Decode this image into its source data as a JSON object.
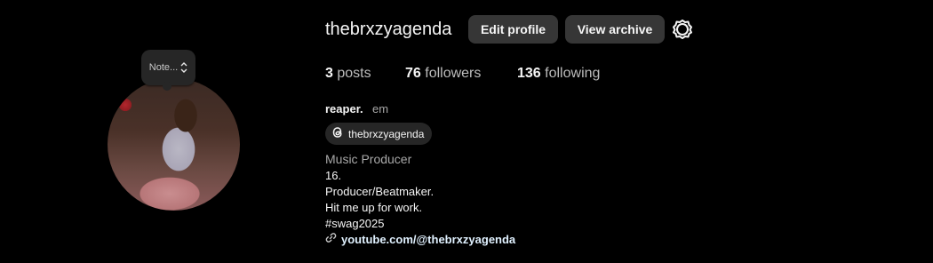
{
  "profile": {
    "username": "thebrxzyagenda",
    "note_placeholder": "Note...",
    "name": "reaper.",
    "pronouns": "em",
    "threads_handle": "thebrxzyagenda",
    "category": "Music Producer",
    "bio_lines": [
      "16.",
      "Producer/Beatmaker.",
      "Hit me up for work.",
      "#swag2025"
    ],
    "link": "youtube.com/@thebrxzyagenda"
  },
  "buttons": {
    "edit_profile": "Edit profile",
    "view_archive": "View archive"
  },
  "stats": {
    "posts_count": "3",
    "posts_label": "posts",
    "followers_count": "76",
    "followers_label": "followers",
    "following_count": "136",
    "following_label": "following"
  },
  "icons": {
    "settings": "gear-icon",
    "threads": "threads-icon",
    "link": "link-icon",
    "note_toggle": "chevron-up-down-icon"
  },
  "colors": {
    "background": "#000000",
    "button_bg": "#363636",
    "text_primary": "#f5f5f5",
    "text_secondary": "#a8a8a8",
    "link": "#e0f1ff"
  }
}
